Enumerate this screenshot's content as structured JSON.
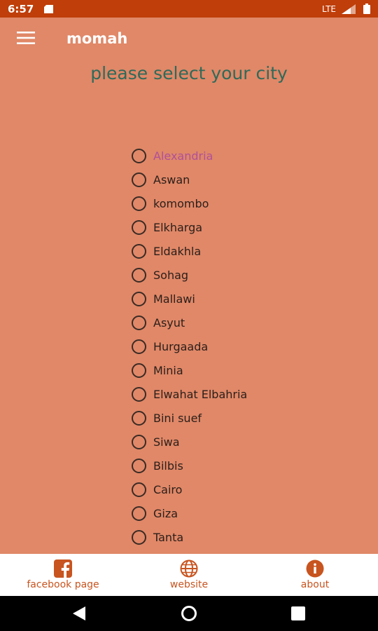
{
  "status_bar": {
    "time": "6:57",
    "network": "LTE",
    "icons": [
      "sd-card-icon",
      "signal-icon",
      "battery-icon"
    ]
  },
  "app_bar": {
    "title": "momah",
    "menu_icon": "hamburger-menu-icon"
  },
  "heading": "please select your city",
  "cities": [
    {
      "label": "Alexandria",
      "selected": true
    },
    {
      "label": "Aswan"
    },
    {
      "label": "komombo"
    },
    {
      "label": "Elkharga"
    },
    {
      "label": "Eldakhla"
    },
    {
      "label": "Sohag"
    },
    {
      "label": "Mallawi"
    },
    {
      "label": "Asyut"
    },
    {
      "label": "Hurgaada"
    },
    {
      "label": "Minia"
    },
    {
      "label": "Elwahat Elbahria"
    },
    {
      "label": "Bini suef"
    },
    {
      "label": "Siwa"
    },
    {
      "label": "Bilbis"
    },
    {
      "label": "Cairo"
    },
    {
      "label": "Giza"
    },
    {
      "label": "Tanta"
    }
  ],
  "bottom_nav": {
    "facebook": {
      "label": "facebook page",
      "icon": "facebook-icon"
    },
    "website": {
      "label": "website",
      "icon": "globe-icon"
    },
    "about": {
      "label": "about",
      "icon": "info-icon"
    }
  },
  "system_nav": [
    "back-icon",
    "home-icon",
    "recents-icon"
  ],
  "colors": {
    "status_bar": "#BF3E0A",
    "background": "#E08868",
    "heading": "#2E6A5A",
    "selected_text": "#B0509A",
    "accent": "#C8541F"
  }
}
